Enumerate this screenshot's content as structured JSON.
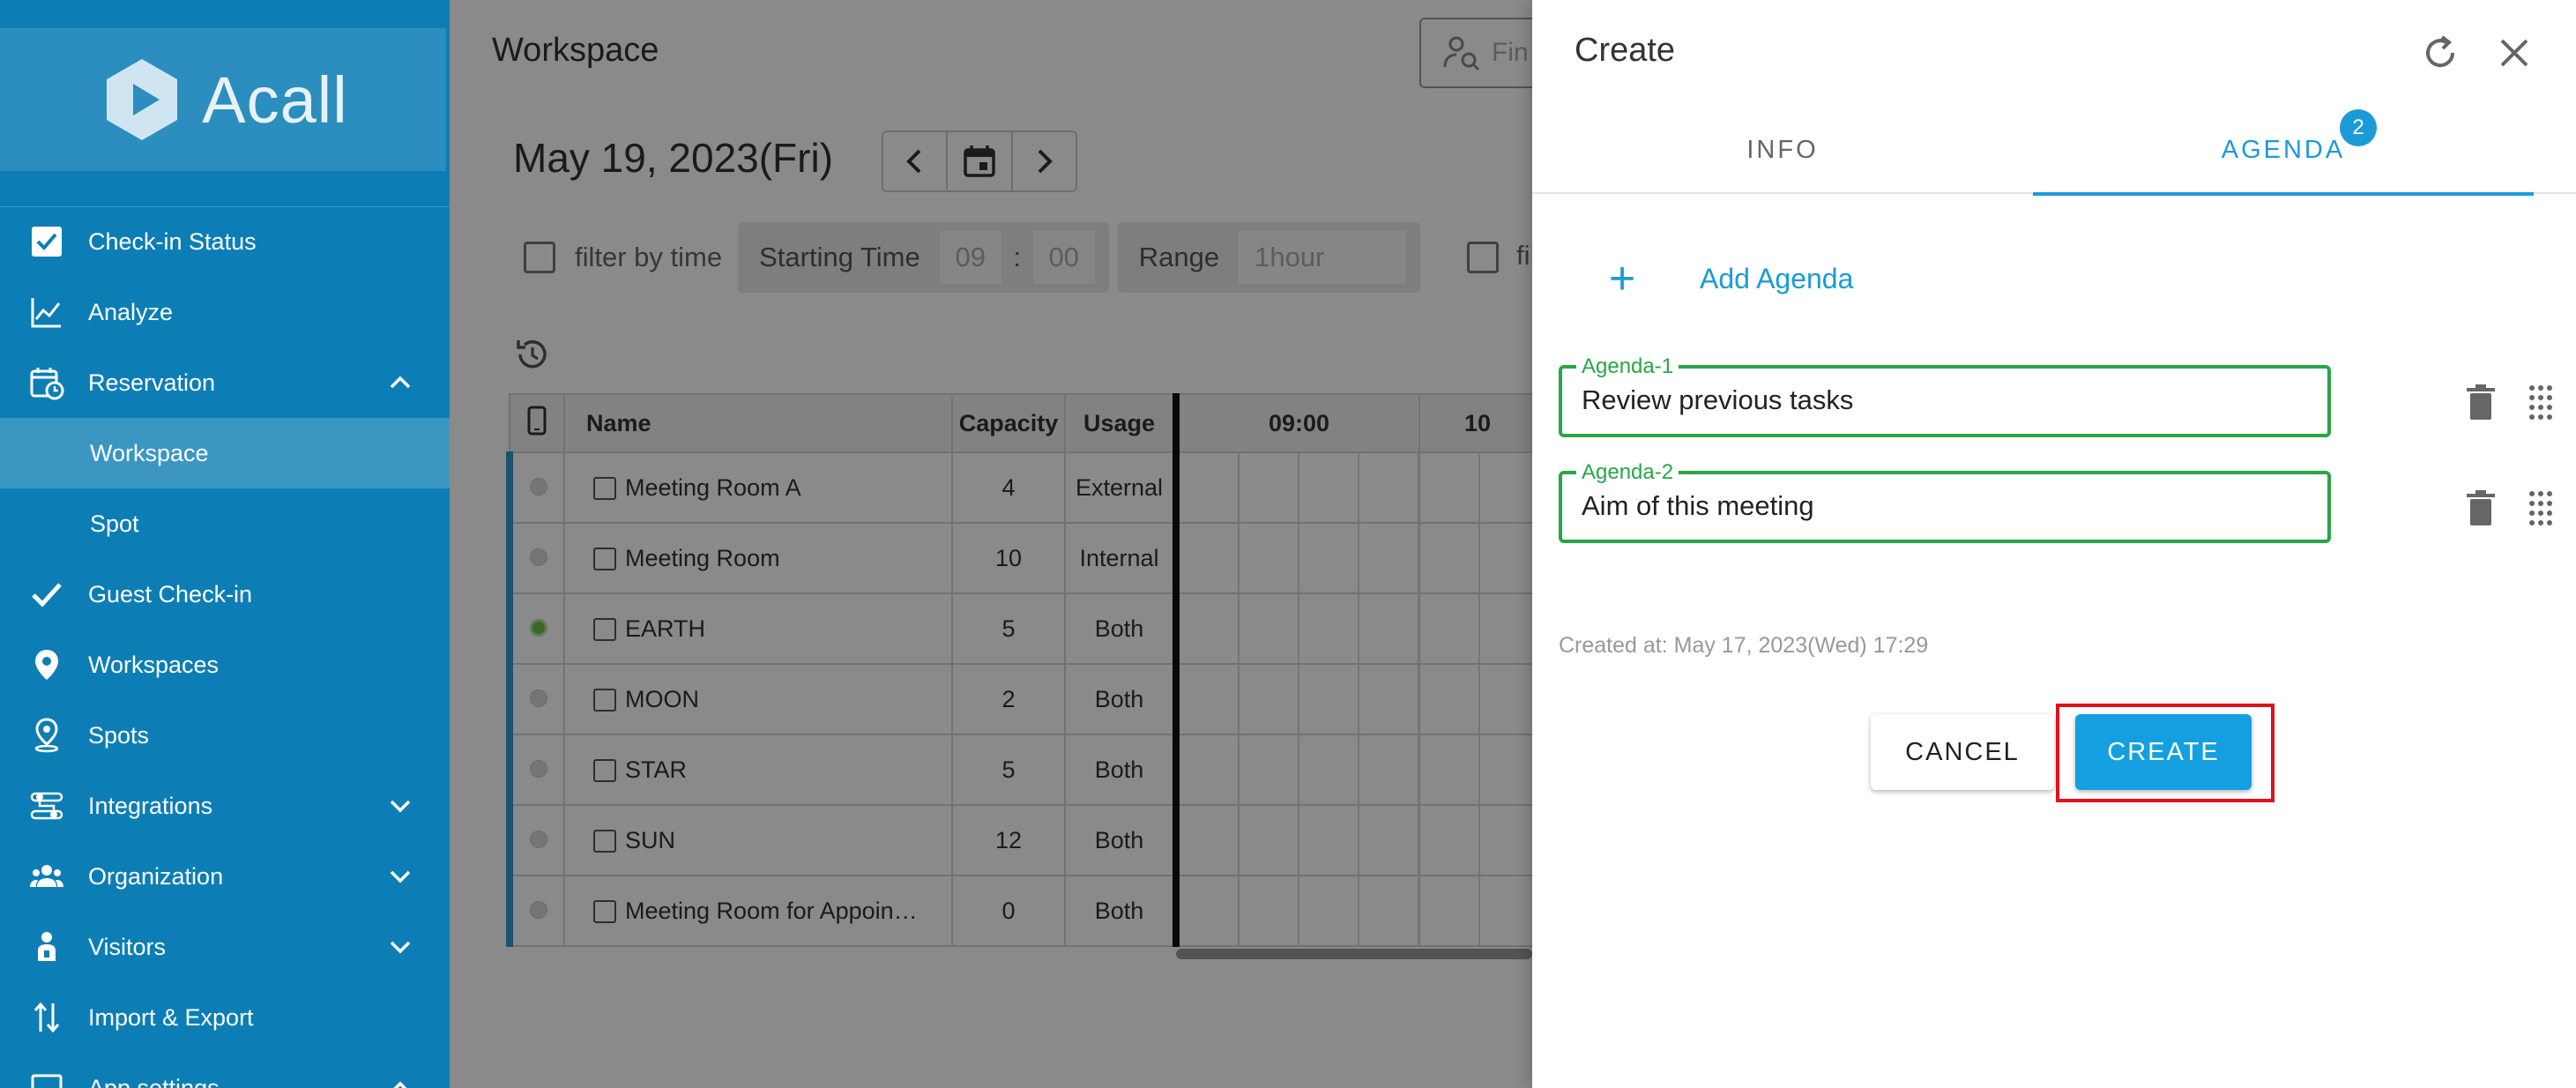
{
  "sidebar": {
    "logo_text": "Acall",
    "items": [
      {
        "label": "Check-in Status",
        "icon": "checkbox-icon"
      },
      {
        "label": "Analyze",
        "icon": "chart-line-icon"
      },
      {
        "label": "Reservation",
        "icon": "calendar-clock-icon"
      },
      {
        "label": "Workspace"
      },
      {
        "label": "Spot"
      },
      {
        "label": "Guest Check-in",
        "icon": "check-icon"
      },
      {
        "label": "Workspaces",
        "icon": "location-pin-icon"
      },
      {
        "label": "Spots",
        "icon": "person-pin-icon"
      },
      {
        "label": "Integrations",
        "icon": "integrations-icon"
      },
      {
        "label": "Organization",
        "icon": "group-icon"
      },
      {
        "label": "Visitors",
        "icon": "visitor-icon"
      },
      {
        "label": "Import & Export",
        "icon": "import-export-icon"
      },
      {
        "label": "App settings",
        "icon": "settings-icon"
      }
    ]
  },
  "main": {
    "title": "Workspace",
    "find_placeholder": "Fin",
    "date": "May 19, 2023(Fri)",
    "filter_by_time": "filter by time",
    "starting_time_label": "Starting Time",
    "start_hour": "09",
    "time_separator": ":",
    "start_minute": "00",
    "range_label": "Range",
    "range_value": "1hour",
    "filter2_text": "fi",
    "table": {
      "headers": {
        "name": "Name",
        "capacity": "Capacity",
        "usage": "Usage",
        "slot1": "09:00",
        "slot2": "10"
      },
      "rows": [
        {
          "name": "Meeting Room A",
          "capacity": "4",
          "usage": "External",
          "status": "off"
        },
        {
          "name": "Meeting Room",
          "capacity": "10",
          "usage": "Internal",
          "status": "off"
        },
        {
          "name": "EARTH",
          "capacity": "5",
          "usage": "Both",
          "status": "on"
        },
        {
          "name": "MOON",
          "capacity": "2",
          "usage": "Both",
          "status": "off"
        },
        {
          "name": "STAR",
          "capacity": "5",
          "usage": "Both",
          "status": "off"
        },
        {
          "name": "SUN",
          "capacity": "12",
          "usage": "Both",
          "status": "off"
        },
        {
          "name": "Meeting Room for Appoin…",
          "capacity": "0",
          "usage": "Both",
          "status": "off"
        }
      ]
    }
  },
  "drawer": {
    "title": "Create",
    "tabs": [
      {
        "label": "INFO",
        "active": false
      },
      {
        "label": "AGENDA",
        "active": true,
        "badge": "2"
      }
    ],
    "add_agenda_label": "Add Agenda",
    "add_agenda_icon": "+",
    "agenda_items": [
      {
        "label": "Agenda-1",
        "value": "Review previous tasks"
      },
      {
        "label": "Agenda-2",
        "value": "Aim of this meeting"
      }
    ],
    "created_at": "Created at: May 17, 2023(Wed) 17:29",
    "cancel_label": "CANCEL",
    "create_label": "CREATE"
  },
  "colors": {
    "sidebar_bg": "#0c7eb5",
    "accent": "#1b9bd7",
    "create_button": "#14a0e0",
    "field_border": "#27a745",
    "highlight": "#e0121a"
  }
}
